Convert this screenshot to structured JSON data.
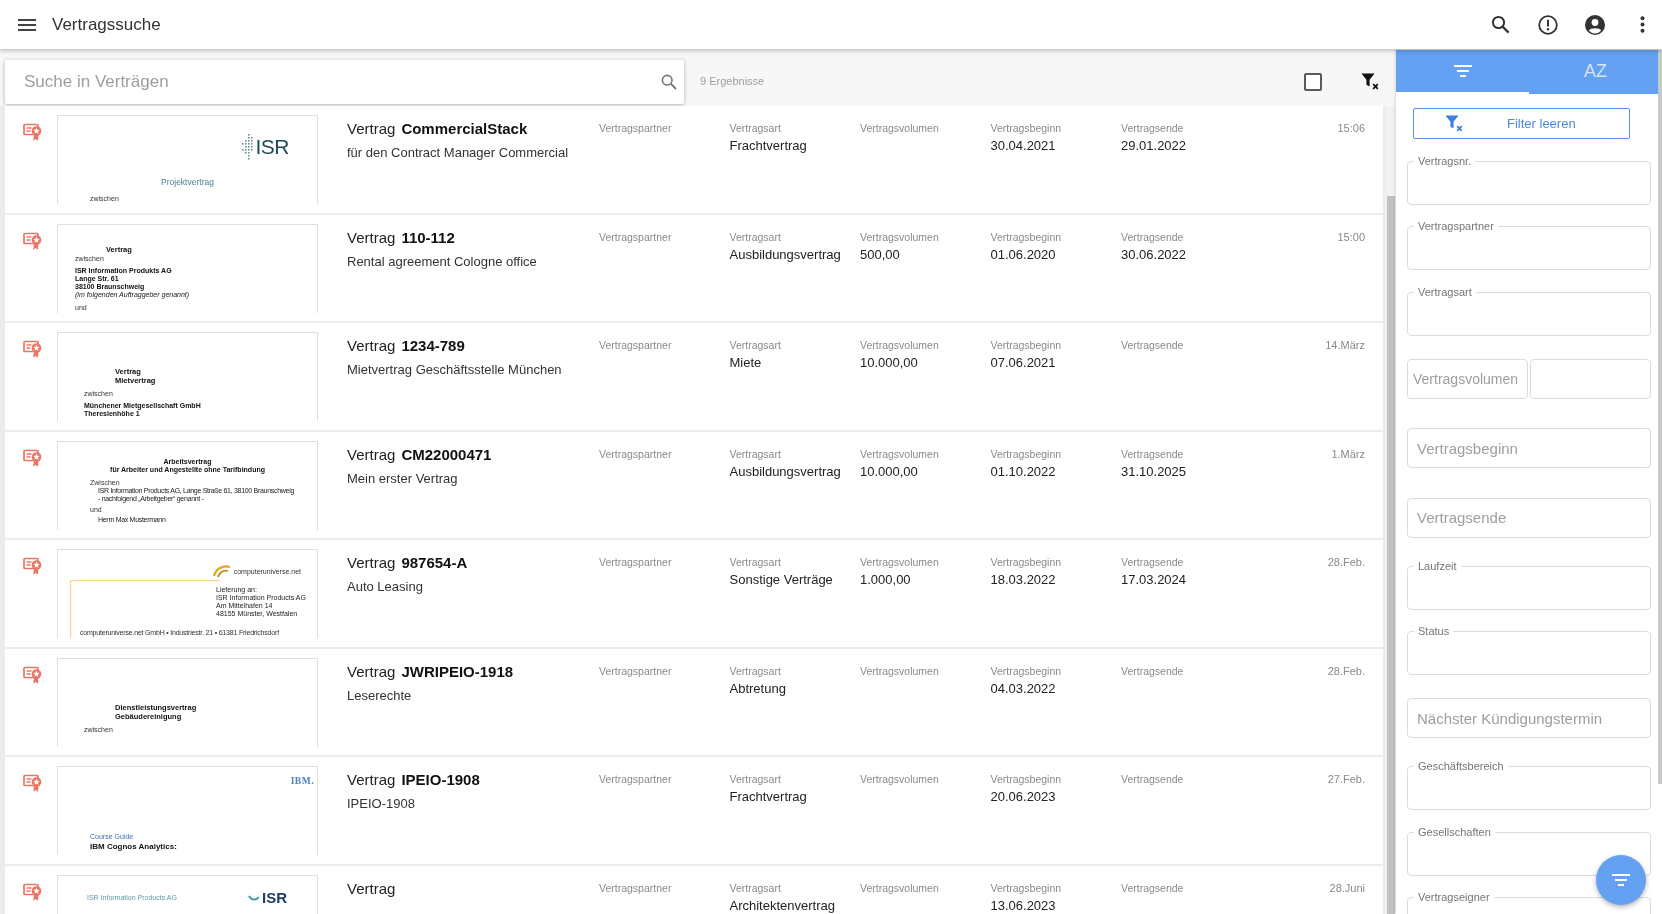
{
  "app_bar": {
    "title": "Vertragssuche"
  },
  "search": {
    "placeholder": "Suche in Verträgen"
  },
  "toolbar": {
    "result_count": "9 Ergebnisse",
    "select_all": {
      "checked": false
    }
  },
  "contracts": [
    {
      "title": "Vertrag",
      "number": "CommercialStack",
      "subtitle": "für den Contract Manager Commercial",
      "time": "15:06",
      "fields": [
        {
          "label": "Vertragspartner"
        },
        {
          "label": "Vertragsart",
          "value": "Frachtvertrag"
        },
        {
          "label": "Vertragsvolumen"
        },
        {
          "label": "Vertragsbeginn",
          "value": "30.04.2021"
        },
        {
          "label": "Vertragsende",
          "value": "29.01.2022"
        }
      ],
      "preview": {
        "kind": "cover",
        "lines": [
          {
            "kind": "logo",
            "text": "ISR"
          },
          {
            "kind": "title",
            "text": "Projektvertrag"
          },
          {
            "kind": "tiny",
            "text": "zwischen"
          }
        ]
      }
    },
    {
      "title": "Vertrag",
      "number": "110-112",
      "subtitle": "Rental agreement Cologne office",
      "time": "15:00",
      "fields": [
        {
          "label": "Vertragspartner"
        },
        {
          "label": "Vertragsart",
          "value": "Ausbildungsvertrag"
        },
        {
          "label": "Vertragsvolumen",
          "value": "500,00"
        },
        {
          "label": "Vertragsbeginn",
          "value": "01.06.2020"
        },
        {
          "label": "Vertragsende",
          "value": "30.06.2022"
        }
      ],
      "preview": {
        "kind": "memo",
        "lines": [
          {
            "kind": "heading",
            "text": "Vertrag"
          },
          {
            "kind": "tiny",
            "text": "zwischen"
          },
          {
            "kind": "bold",
            "text": "ISR Information Produkts AG"
          },
          {
            "kind": "bold",
            "text": "Lange Str. 61"
          },
          {
            "kind": "bold",
            "text": "38100 Braunschweig"
          },
          {
            "kind": "italic",
            "text": "(im folgenden Auftraggeber genannt)"
          },
          {
            "kind": "tiny",
            "text": "und"
          }
        ]
      }
    },
    {
      "title": "Vertrag",
      "number": "1234-789",
      "subtitle": "Mietvertrag Geschäftsstelle München",
      "time": "14.März",
      "fields": [
        {
          "label": "Vertragspartner"
        },
        {
          "label": "Vertragsart",
          "value": "Miete"
        },
        {
          "label": "Vertragsvolumen",
          "value": "10.000,00"
        },
        {
          "label": "Vertragsbeginn",
          "value": "07.06.2021"
        },
        {
          "label": "Vertragsende"
        }
      ],
      "preview": {
        "kind": "deed",
        "lines": [
          {
            "kind": "heading",
            "text": "Vertrag"
          },
          {
            "kind": "heading",
            "text": "Mietvertrag"
          },
          {
            "kind": "tiny",
            "text": "zwischen"
          },
          {
            "kind": "bold",
            "text": "Münchener Mietgesellschaft GmbH"
          },
          {
            "kind": "bold",
            "text": "Theresienhöhe 1"
          }
        ]
      }
    },
    {
      "title": "Vertrag",
      "number": "CM22000471",
      "subtitle": "Mein erster Vertrag",
      "time": "1.März",
      "fields": [
        {
          "label": "Vertragspartner"
        },
        {
          "label": "Vertragsart",
          "value": "Ausbildungsvertrag"
        },
        {
          "label": "Vertragsvolumen",
          "value": "10.000,00"
        },
        {
          "label": "Vertragsbeginn",
          "value": "01.10.2022"
        },
        {
          "label": "Vertragsende",
          "value": "31.10.2025"
        }
      ],
      "preview": {
        "kind": "centered",
        "lines": [
          {
            "kind": "heading",
            "text": "Arbeitsvertrag"
          },
          {
            "kind": "heading",
            "text": "für Arbeiter und Angestellte ohne Tarifbindung"
          },
          {
            "kind": "tiny",
            "text": "Zwischen"
          },
          {
            "kind": "text",
            "text": "ISR Information Products AG, Lange Straße 61, 38100 Braunschweig"
          },
          {
            "kind": "text",
            "text": "- nachfolgend „Arbeitgeber“ genannt -"
          },
          {
            "kind": "tiny",
            "text": "und"
          },
          {
            "kind": "text",
            "text": "Herrn Max Mustermann"
          }
        ]
      }
    },
    {
      "title": "Vertrag",
      "number": "987654-A",
      "subtitle": "Auto Leasing",
      "time": "28.Feb.",
      "fields": [
        {
          "label": "Vertragspartner"
        },
        {
          "label": "Vertragsart",
          "value": "Sonstige Verträge"
        },
        {
          "label": "Vertragsvolumen",
          "value": "1.000,00"
        },
        {
          "label": "Vertragsbeginn",
          "value": "18.03.2022"
        },
        {
          "label": "Vertragsende",
          "value": "17.03.2024"
        }
      ],
      "preview": {
        "kind": "letter",
        "lines": [
          {
            "kind": "logo",
            "text": "computeruniverse.net"
          },
          {
            "kind": "text",
            "text": "Lieferung an:"
          },
          {
            "kind": "text",
            "text": "ISR Information Products AG"
          },
          {
            "kind": "text",
            "text": "Am Mittelhafen 14"
          },
          {
            "kind": "text",
            "text": "48155 Münster, Westfalen"
          },
          {
            "kind": "footer",
            "text": "computeruniverse.net GmbH • Industriestr. 21 • 61381 Friedrichsdorf"
          }
        ]
      }
    },
    {
      "title": "Vertrag",
      "number": "JWRIPEIO-1918",
      "subtitle": "Leserechte",
      "time": "28.Feb.",
      "fields": [
        {
          "label": "Vertragspartner"
        },
        {
          "label": "Vertragsart",
          "value": "Abtretung"
        },
        {
          "label": "Vertragsvolumen"
        },
        {
          "label": "Vertragsbeginn",
          "value": "04.03.2022"
        },
        {
          "label": "Vertragsende"
        }
      ],
      "preview": {
        "kind": "notice",
        "lines": [
          {
            "kind": "heading",
            "text": "Dienstleistungsvertrag"
          },
          {
            "kind": "heading",
            "text": "Gebäudereinigung"
          },
          {
            "kind": "tiny",
            "text": "zwischen"
          }
        ]
      }
    },
    {
      "title": "Vertrag",
      "number": "IPEIO-1908",
      "subtitle": "IPEIO-1908",
      "time": "27.Feb.",
      "fields": [
        {
          "label": "Vertragspartner"
        },
        {
          "label": "Vertragsart",
          "value": "Frachtvertrag"
        },
        {
          "label": "Vertragsvolumen"
        },
        {
          "label": "Vertragsbeginn",
          "value": "20.06.2023"
        },
        {
          "label": "Vertragsende"
        }
      ],
      "preview": {
        "kind": "course",
        "lines": [
          {
            "kind": "logo",
            "text": "IBM."
          },
          {
            "kind": "title",
            "text": "Course Guide"
          },
          {
            "kind": "heading",
            "text": "IBM Cognos Analytics:"
          }
        ]
      }
    },
    {
      "title": "Vertrag",
      "time": "28.Juni",
      "fields": [
        {
          "label": "Vertragspartner"
        },
        {
          "label": "Vertragsart",
          "value": "Architektenvertrag"
        },
        {
          "label": "Vertragsvolumen"
        },
        {
          "label": "Vertragsbeginn",
          "value": "13.06.2023"
        },
        {
          "label": "Vertragsende"
        }
      ],
      "preview": {
        "kind": "letterhead",
        "lines": [
          {
            "kind": "tiny",
            "text": "ISR Information Products AG"
          },
          {
            "kind": "logo",
            "text": "ISR"
          }
        ]
      }
    }
  ],
  "filter_panel": {
    "tabs": [
      {
        "kind": "filter",
        "selected": true
      },
      {
        "kind": "sort",
        "label": "AZ",
        "selected": false
      }
    ],
    "clear_button": "Filter leeren",
    "fields": [
      {
        "kind": "labeled",
        "label": "Vertragsnr."
      },
      {
        "kind": "labeled",
        "label": "Vertragspartner"
      },
      {
        "kind": "labeled",
        "label": "Vertragsart"
      },
      {
        "kind": "range",
        "placeholder": "Vertragsvolumen"
      },
      {
        "kind": "placeholder",
        "placeholder": "Vertragsbeginn"
      },
      {
        "kind": "placeholder",
        "placeholder": "Vertragsende"
      },
      {
        "kind": "labeled",
        "label": "Laufzeit"
      },
      {
        "kind": "labeled",
        "label": "Status"
      },
      {
        "kind": "placeholder",
        "placeholder": "Nächster Kündigungstermin"
      },
      {
        "kind": "labeled",
        "label": "Geschäftsbereich"
      },
      {
        "kind": "labeled",
        "label": "Gesellschaften"
      },
      {
        "kind": "labeled",
        "label": "Vertragseigner"
      }
    ]
  }
}
